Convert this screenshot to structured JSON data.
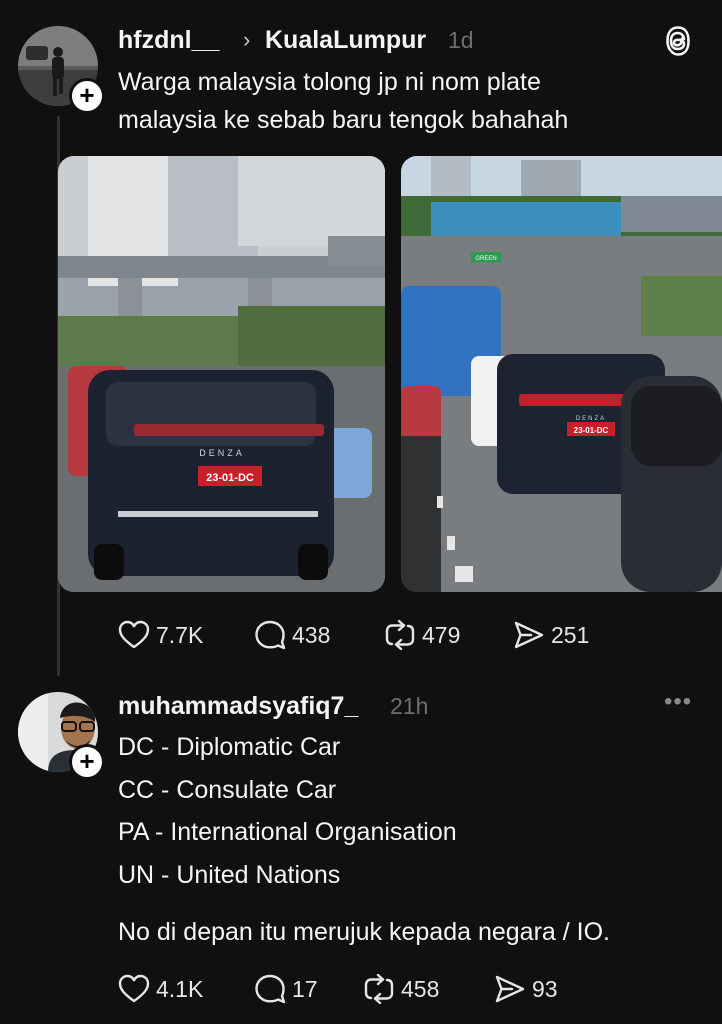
{
  "post1": {
    "username": "hfzdnl__",
    "topic": "KualaLumpur",
    "time": "1d",
    "text_lines": [
      "Warga malaysia tolong jp ni nom plate",
      "malaysia ke sebab baru tengok bahahah"
    ],
    "images": [
      {
        "plate": "23-01-DC",
        "brand": "DENZA"
      },
      {
        "plate": "23-01-DC",
        "brand": "DENZA",
        "bus_label": "GREEN"
      }
    ],
    "stats": {
      "likes": "7.7K",
      "replies": "438",
      "reposts": "479",
      "shares": "251"
    }
  },
  "post2": {
    "username": "muhammadsyafiq7_",
    "time": "21h",
    "text_lines": [
      "DC - Diplomatic Car",
      "CC - Consulate Car",
      "PA - International Organisation",
      "UN - United Nations"
    ],
    "text_footer": "No di depan itu merujuk kepada negara / IO.",
    "stats": {
      "likes": "4.1K",
      "replies": "17",
      "reposts": "458",
      "shares": "93"
    }
  },
  "icons": {
    "threads_logo": "threads-logo-icon",
    "more": "more-horizontal-icon",
    "like": "heart-icon",
    "reply": "comment-icon",
    "repost": "repost-icon",
    "share": "share-icon",
    "follow": "plus-icon"
  },
  "colors": {
    "background": "#101010",
    "text": "#f3f5f7",
    "muted": "#6f6f6f",
    "plate_red": "#c8202a"
  }
}
